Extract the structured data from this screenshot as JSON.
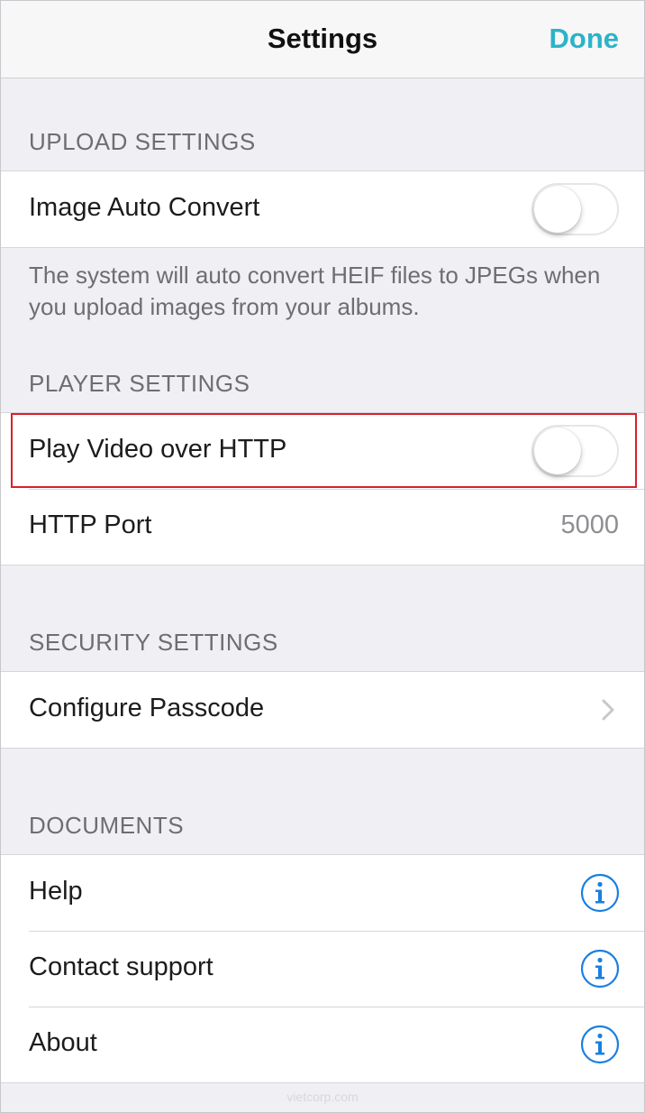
{
  "nav": {
    "title": "Settings",
    "done_label": "Done"
  },
  "upload": {
    "header": "UPLOAD SETTINGS",
    "image_auto_convert": {
      "label": "Image Auto Convert",
      "on": false
    },
    "footnote": "The system will auto convert HEIF files to JPEGs when you upload images from your albums."
  },
  "player": {
    "header": "PLAYER SETTINGS",
    "play_video_http": {
      "label": "Play Video over HTTP",
      "on": false
    },
    "http_port": {
      "label": "HTTP Port",
      "value": "5000"
    }
  },
  "security": {
    "header": "SECURITY SETTINGS",
    "configure_passcode": {
      "label": "Configure Passcode",
      "icon": "chevron-right-icon"
    }
  },
  "documents": {
    "header": "DOCUMENTS",
    "items": [
      {
        "label": "Help",
        "icon": "info-icon"
      },
      {
        "label": "Contact support",
        "icon": "info-icon"
      },
      {
        "label": "About",
        "icon": "info-icon"
      }
    ]
  },
  "watermark": "vietcorp.com",
  "colors": {
    "accent": "#2bb3c8",
    "info_blue": "#1a7fe0",
    "highlight": "#d9202a",
    "background": "#efeff4"
  }
}
